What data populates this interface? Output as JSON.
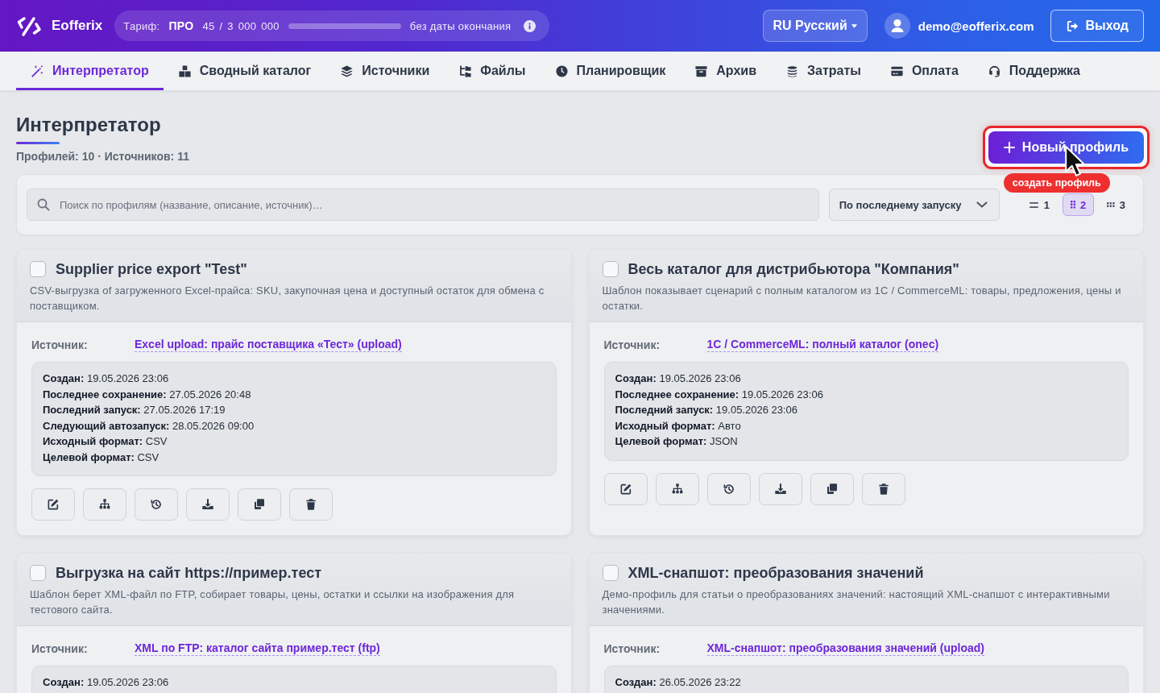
{
  "header": {
    "brand": "Eofferix",
    "tariff": {
      "label": "Тариф:",
      "plan": "ПРО",
      "usage": "45 / 3 000 000",
      "expiry": "без даты окончания"
    },
    "language": "RU Русский",
    "user_email": "demo@eofferix.com",
    "logout": "Выход"
  },
  "nav": {
    "tabs": [
      {
        "label": "Интерпретатор",
        "selected": true
      },
      {
        "label": "Сводный каталог",
        "selected": false
      },
      {
        "label": "Источники",
        "selected": false
      },
      {
        "label": "Файлы",
        "selected": false
      },
      {
        "label": "Планировщик",
        "selected": false
      },
      {
        "label": "Архив",
        "selected": false
      },
      {
        "label": "Затраты",
        "selected": false
      },
      {
        "label": "Оплата",
        "selected": false
      },
      {
        "label": "Поддержка",
        "selected": false
      }
    ]
  },
  "page": {
    "title": "Интерпретатор",
    "summary": "Профилей: 10 · Источников: 11",
    "new_profile_button": {
      "label": "Новый профиль",
      "highlighted": true
    },
    "hint": "создать профиль"
  },
  "filters": {
    "search": {
      "placeholder": "Поиск по профилям (название, описание, источник)…"
    },
    "sort": "По последнему запуску",
    "view_options": [
      {
        "label": "1",
        "selected": false
      },
      {
        "label": "2",
        "selected": true
      },
      {
        "label": "3",
        "selected": false
      }
    ]
  },
  "profiles": [
    {
      "checked": false,
      "title": "Supplier price export \"Test\"",
      "description": "CSV-выгрузка of загруженного Excel-прайса: SKU, закупочная цена и доступный остаток для обмена с поставщиком.",
      "source_label": "Источник:",
      "source": "Excel upload: прайс поставщика «Тест» (upload)",
      "details": [
        {
          "label": "Создан:",
          "value": "19.05.2026 23:06"
        },
        {
          "label": "Последнее сохранение:",
          "value": "27.05.2026 20:48"
        },
        {
          "label": "Последний запуск:",
          "value": "27.05.2026 17:19"
        },
        {
          "label": "Следующий автозапуск:",
          "value": "28.05.2026 09:00"
        },
        {
          "label": "Исходный формат:",
          "value": "CSV"
        },
        {
          "label": "Целевой формат:",
          "value": "CSV"
        }
      ],
      "actions": [
        {
          "kind": "edit"
        },
        {
          "kind": "structure"
        },
        {
          "kind": "history"
        },
        {
          "kind": "download"
        },
        {
          "kind": "duplicate"
        },
        {
          "kind": "delete"
        }
      ]
    },
    {
      "checked": false,
      "title": "Весь каталог для дистрибьютора \"Компания\"",
      "description": "Шаблон показывает сценарий с полным каталогом из 1С / CommerceML: товары, предложения, цены и остатки.",
      "source_label": "Источник:",
      "source": "1С / CommerceML: полный каталог (onec)",
      "details": [
        {
          "label": "Создан:",
          "value": "19.05.2026 23:06"
        },
        {
          "label": "Последнее сохранение:",
          "value": "19.05.2026 23:06"
        },
        {
          "label": "Последний запуск:",
          "value": "19.05.2026 23:06"
        },
        {
          "label": "Исходный формат:",
          "value": "Авто"
        },
        {
          "label": "Целевой формат:",
          "value": "JSON"
        }
      ],
      "actions": [
        {
          "kind": "edit"
        },
        {
          "kind": "structure"
        },
        {
          "kind": "history"
        },
        {
          "kind": "download"
        },
        {
          "kind": "duplicate"
        },
        {
          "kind": "delete"
        }
      ]
    },
    {
      "checked": false,
      "title": "Выгрузка на сайт https://пример.тест",
      "description": "Шаблон берет XML-файл по FTP, собирает товары, цены, остатки и ссылки на изображения для тестового сайта.",
      "source_label": "Источник:",
      "source": "XML по FTP: каталог сайта пример.тест (ftp)",
      "details": [
        {
          "label": "Создан:",
          "value": "19.05.2026 23:06"
        }
      ]
    },
    {
      "checked": false,
      "title": "XML-снапшот: преобразования значений",
      "description": "Демо-профиль для статьи о преобразованиях значений: настоящий XML-снапшот с интерактивными значениями.",
      "source_label": "Источник:",
      "source": "XML-снапшот: преобразования значений (upload)",
      "details": [
        {
          "label": "Создан:",
          "value": "26.05.2026 23:22"
        }
      ]
    }
  ]
}
